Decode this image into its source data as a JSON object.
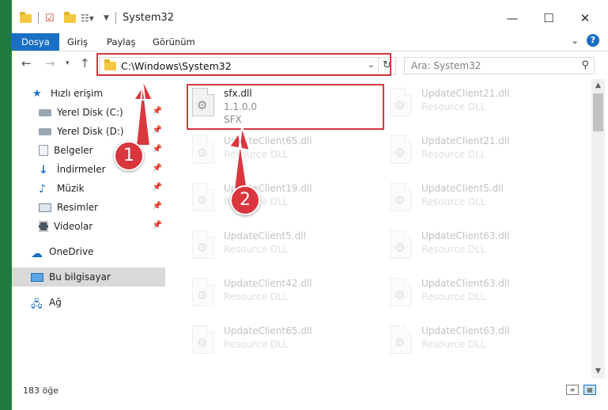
{
  "window": {
    "title": "System32"
  },
  "ribbon": {
    "tabs": [
      "Dosya",
      "Giriş",
      "Paylaş",
      "Görünüm"
    ]
  },
  "nav": {
    "address": "C:\\Windows\\System32",
    "search_placeholder": "Ara: System32"
  },
  "sidebar": {
    "quick_access": "Hızlı erişim",
    "items": [
      "Yerel Disk (C:)",
      "Yerel Disk (D:)",
      "Belgeler",
      "İndirmeler",
      "Müzik",
      "Resimler",
      "Videolar"
    ],
    "onedrive": "OneDrive",
    "this_pc": "Bu bilgisayar",
    "network": "Ağ"
  },
  "files": [
    {
      "name": "sfx.dll",
      "line2": "1.1.0.0",
      "line3": "SFX"
    },
    {
      "name": "UpdateClient21.dll",
      "line2": "Resource DLL"
    },
    {
      "name": "UpdateClient65.dll",
      "line2": "Resource DLL"
    },
    {
      "name": "UpdateClient21.dll",
      "line2": "Resource DLL"
    },
    {
      "name": "UpdateClient19.dll",
      "line2": "Resource DLL"
    },
    {
      "name": "UpdateClient5.dll",
      "line2": "Resource DLL"
    },
    {
      "name": "UpdateClient5.dll",
      "line2": "Resource DLL"
    },
    {
      "name": "UpdateClient63.dll",
      "line2": "Resource DLL"
    },
    {
      "name": "UpdateClient42.dll",
      "line2": "Resource DLL"
    },
    {
      "name": "UpdateClient63.dll",
      "line2": "Resource DLL"
    },
    {
      "name": "UpdateClient65.dll",
      "line2": "Resource DLL"
    },
    {
      "name": "UpdateClient63.dll",
      "line2": "Resource DLL"
    }
  ],
  "status": {
    "count": "183 öğe"
  },
  "markers": {
    "one": "1",
    "two": "2"
  },
  "colors": {
    "accent": "#1a6fc4",
    "highlight": "#d9363e",
    "desktop": "#1f7a3c"
  }
}
